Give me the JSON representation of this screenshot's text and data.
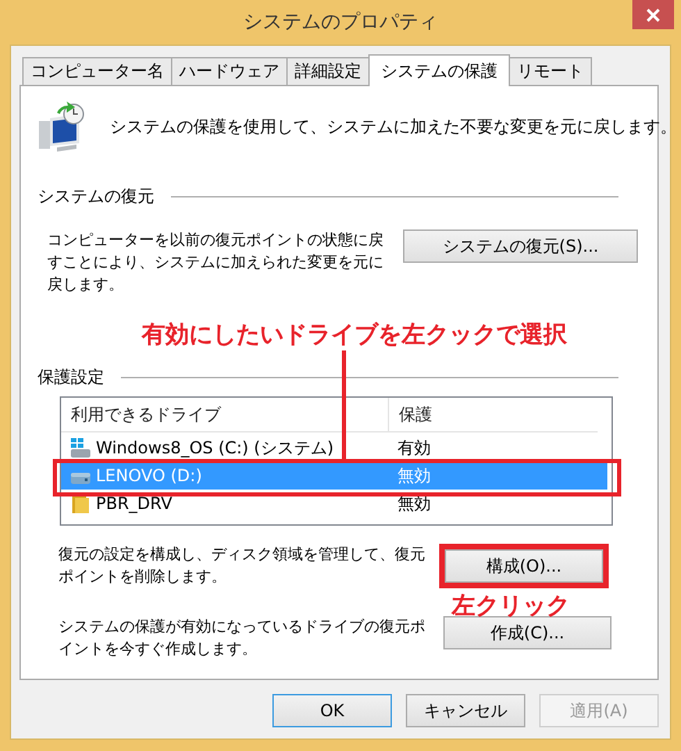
{
  "window": {
    "title": "システムのプロパティ"
  },
  "tabs": [
    {
      "label": "コンピューター名",
      "selected": false
    },
    {
      "label": "ハードウェア",
      "selected": false
    },
    {
      "label": "詳細設定",
      "selected": false
    },
    {
      "label": "システムの保護",
      "selected": true
    },
    {
      "label": "リモート",
      "selected": false
    }
  ],
  "intro": "システムの保護を使用して、システムに加えた不要な変更を元に戻します。",
  "restore_section": {
    "title": "システムの復元",
    "description": "コンピューターを以前の復元ポイントの状態に戻すことにより、システムに加えられた変更を元に戻します。",
    "button": "システムの復元(S)..."
  },
  "protection_section": {
    "title": "保護設定",
    "columns": [
      "利用できるドライブ",
      "保護"
    ],
    "drives": [
      {
        "kind": "system",
        "name": "Windows8_OS (C:) (システム)",
        "protection": "有効",
        "selected": false
      },
      {
        "kind": "drive",
        "name": "LENOVO (D:)",
        "protection": "無効",
        "selected": true
      },
      {
        "kind": "folder",
        "name": "PBR_DRV",
        "protection": "無効",
        "selected": false
      }
    ],
    "configure": {
      "description": "復元の設定を構成し、ディスク領域を管理して、復元ポイントを削除します。",
      "button": "構成(O)..."
    },
    "create": {
      "description": "システムの保護が有効になっているドライブの復元ポイントを今すぐ作成します。",
      "button": "作成(C)..."
    }
  },
  "buttons": [
    {
      "label": "OK",
      "default": true,
      "disabled": false
    },
    {
      "label": "キャンセル",
      "default": false,
      "disabled": false
    },
    {
      "label": "適用(A)",
      "default": false,
      "disabled": true
    }
  ],
  "annotations": [
    {
      "kind": "select",
      "text": "有効にしたいドライブを左クックで選択"
    },
    {
      "kind": "click",
      "text": "左クリック"
    }
  ]
}
